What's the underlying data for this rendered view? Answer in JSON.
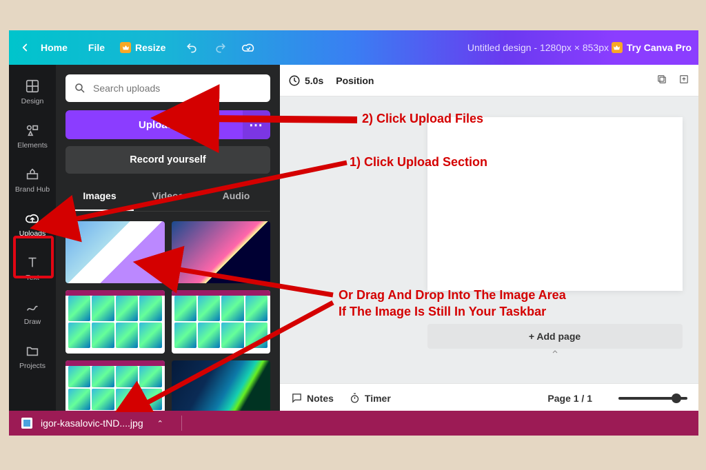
{
  "topbar": {
    "home": "Home",
    "file": "File",
    "resize": "Resize",
    "title": "Untitled design - 1280px × 853px",
    "try_pro": "Try Canva Pro"
  },
  "nav": {
    "design": "Design",
    "elements": "Elements",
    "brandhub": "Brand Hub",
    "uploads": "Uploads",
    "text": "Text",
    "draw": "Draw",
    "projects": "Projects"
  },
  "panel": {
    "search_placeholder": "Search uploads",
    "upload_files": "Upload files",
    "record_yourself": "Record yourself",
    "tabs": {
      "images": "Images",
      "videos": "Videos",
      "audio": "Audio"
    }
  },
  "toolbar": {
    "duration": "5.0s",
    "position": "Position"
  },
  "canvas": {
    "add_page": "+ Add page"
  },
  "footer": {
    "notes": "Notes",
    "timer": "Timer",
    "page": "Page 1 / 1"
  },
  "taskbar": {
    "filename": "igor-kasalovic-tND....jpg"
  },
  "annotations": {
    "step1": "1) Click Upload Section",
    "step2": "2) Click Upload Files",
    "dragdrop1": "Or Drag And Drop Into The Image Area",
    "dragdrop2": "If The Image Is Still In Your Taskbar"
  }
}
